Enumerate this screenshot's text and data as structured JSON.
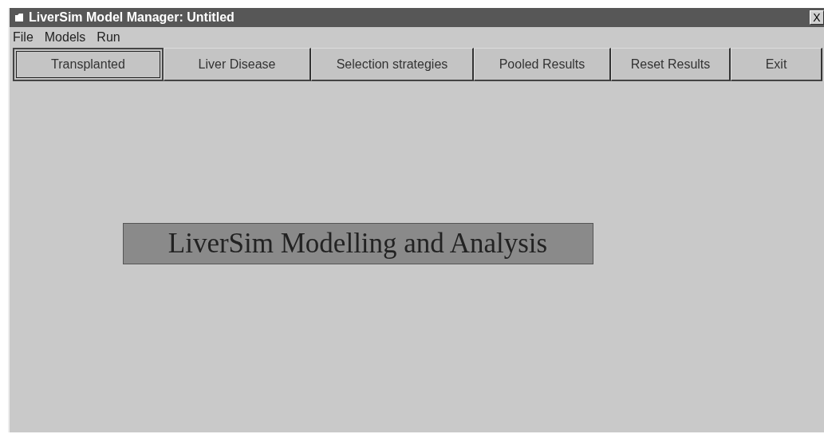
{
  "window": {
    "title": "LiverSim Model Manager: Untitled",
    "close": "X"
  },
  "menu": [
    "File",
    "Models",
    "Run"
  ],
  "toolbar": [
    {
      "label": "Transplanted",
      "selected": true
    },
    {
      "label": "Liver Disease",
      "selected": false
    },
    {
      "label": "Selection strategies",
      "selected": false
    },
    {
      "label": "Pooled Results",
      "selected": false
    },
    {
      "label": "Reset Results",
      "selected": false
    },
    {
      "label": "Exit",
      "selected": false
    }
  ],
  "banner": "LiverSim Modelling and Analysis"
}
